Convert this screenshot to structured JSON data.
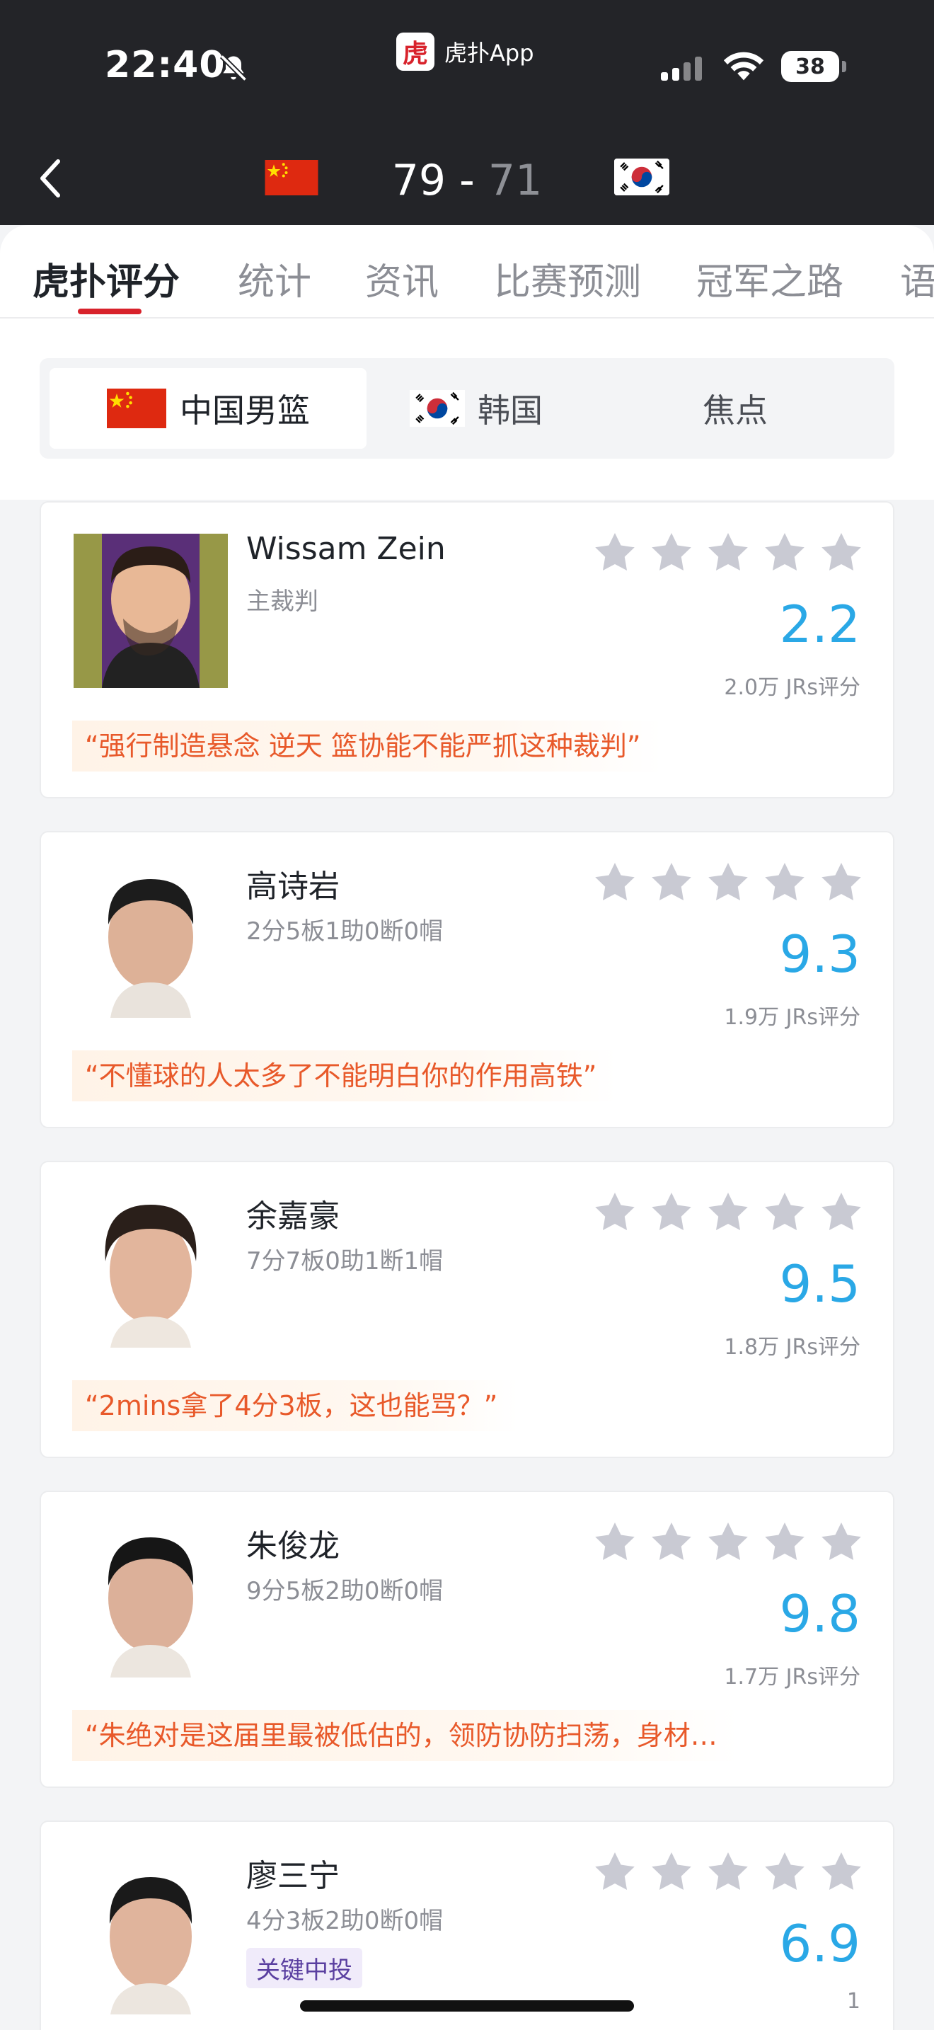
{
  "status_bar": {
    "time": "22:40",
    "app_label": "虎扑App",
    "app_logo_text": "虎",
    "battery": "38"
  },
  "match": {
    "home_score": "79",
    "separator": " - ",
    "away_score": "71"
  },
  "tabs": [
    {
      "label": "虎扑评分"
    },
    {
      "label": "统计"
    },
    {
      "label": "资讯"
    },
    {
      "label": "比赛预测"
    },
    {
      "label": "冠军之路"
    },
    {
      "label": "语"
    }
  ],
  "segments": [
    {
      "label": "中国男篮"
    },
    {
      "label": "韩国"
    },
    {
      "label": "焦点"
    }
  ],
  "players": [
    {
      "name": "Wissam Zein",
      "stat": "主裁判",
      "tag": "",
      "rating": "2.2",
      "votes": "2.0万 JRs评分",
      "quote": "“强行制造悬念 逆天 篮协能不能严抓这种裁判”"
    },
    {
      "name": "高诗岩",
      "stat": "2分5板1助0断0帽",
      "tag": "",
      "rating": "9.3",
      "votes": "1.9万 JRs评分",
      "quote": "“不懂球的人太多了不能明白你的作用高铁”"
    },
    {
      "name": "余嘉豪",
      "stat": "7分7板0助1断1帽",
      "tag": "",
      "rating": "9.5",
      "votes": "1.8万 JRs评分",
      "quote": "“2mins拿了4分3板，这也能骂？”"
    },
    {
      "name": "朱俊龙",
      "stat": "9分5板2助0断0帽",
      "tag": "",
      "rating": "9.8",
      "votes": "1.7万 JRs评分",
      "quote": "“朱绝对是这届里最被低估的，领防协防扫荡，身材…"
    },
    {
      "name": "廖三宁",
      "stat": "4分3板2助0断0帽",
      "tag": "关键中投",
      "rating": "6.9",
      "votes": "1",
      "quote": ""
    }
  ],
  "colors": {
    "accent_red": "#d8222b",
    "rating_blue": "#2aa8e6",
    "quote_orange": "#e8592a"
  }
}
